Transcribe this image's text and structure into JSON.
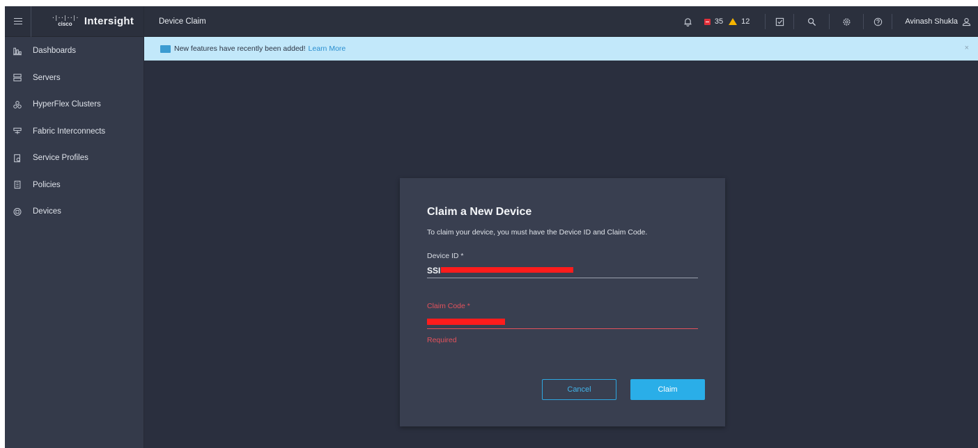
{
  "app": {
    "logo_bars": "·|··|··|·",
    "logo_text": "cisco",
    "name": "Intersight",
    "page_title": "Device Claim"
  },
  "sidebar": {
    "items": [
      {
        "label": "Dashboards",
        "icon": "dashboards-icon"
      },
      {
        "label": "Servers",
        "icon": "servers-icon"
      },
      {
        "label": "HyperFlex Clusters",
        "icon": "hyperflex-clusters-icon"
      },
      {
        "label": "Fabric Interconnects",
        "icon": "fabric-interconnects-icon"
      },
      {
        "label": "Service Profiles",
        "icon": "service-profiles-icon"
      },
      {
        "label": "Policies",
        "icon": "policies-icon"
      },
      {
        "label": "Devices",
        "icon": "devices-icon"
      }
    ]
  },
  "topbar": {
    "critical_count": "35",
    "warning_count": "12",
    "user_name": "Avinash Shukla"
  },
  "banner": {
    "text": "New features have recently been added!",
    "link": "Learn More",
    "close": "×"
  },
  "modal": {
    "title": "Claim a New Device",
    "description": "To claim your device, you must have the Device ID and Claim Code.",
    "device_id_label": "Device ID *",
    "device_id_value": "SSI",
    "claim_code_label": "Claim Code *",
    "claim_code_helper": "Required",
    "cancel_label": "Cancel",
    "claim_label": "Claim"
  },
  "colors": {
    "accent": "#2aaee8",
    "error": "#e4525c",
    "critical": "#e0303a",
    "warning": "#f5b400",
    "banner_bg": "#c2e8fa"
  }
}
